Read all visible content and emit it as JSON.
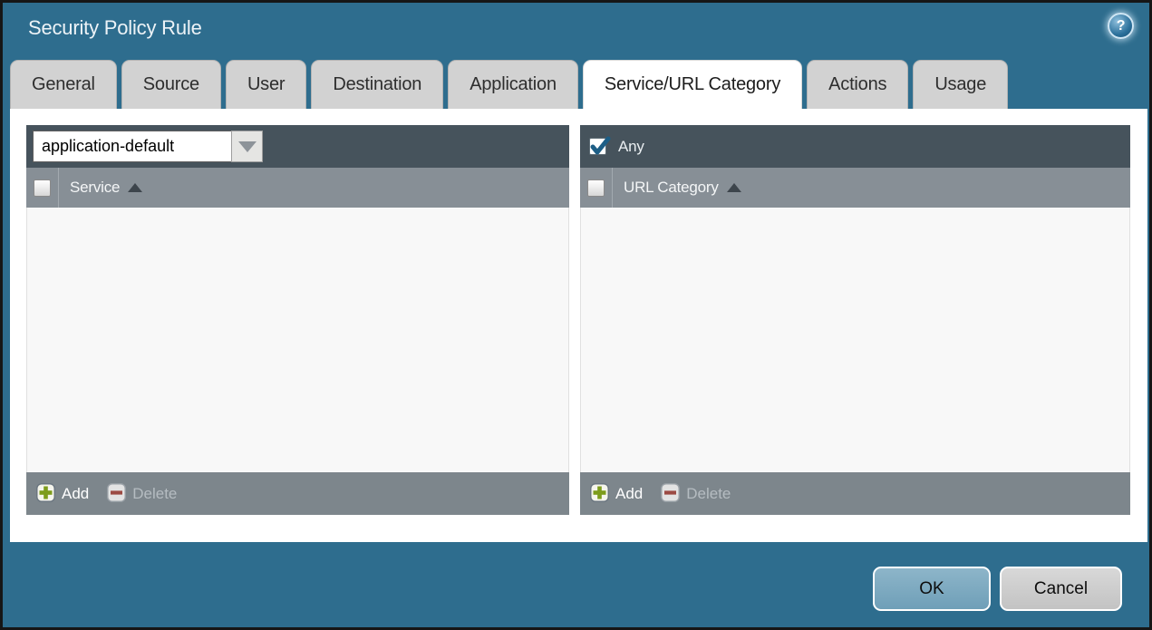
{
  "window": {
    "title": "Security Policy Rule"
  },
  "titlebar": {
    "help_glyph": "?"
  },
  "tabs": [
    {
      "label": "General",
      "active": false
    },
    {
      "label": "Source",
      "active": false
    },
    {
      "label": "User",
      "active": false
    },
    {
      "label": "Destination",
      "active": false
    },
    {
      "label": "Application",
      "active": false
    },
    {
      "label": "Service/URL Category",
      "active": true
    },
    {
      "label": "Actions",
      "active": false
    },
    {
      "label": "Usage",
      "active": false
    }
  ],
  "service_panel": {
    "dropdown": {
      "value": "application-default"
    },
    "select_all_checked": false,
    "column_header": "Service",
    "rows": [],
    "toolbar": {
      "add_label": "Add",
      "delete_label": "Delete",
      "delete_enabled": false
    }
  },
  "url_category_panel": {
    "any_label": "Any",
    "any_checked": true,
    "select_all_checked": false,
    "column_header": "URL Category",
    "rows": [],
    "toolbar": {
      "add_label": "Add",
      "delete_label": "Delete",
      "delete_enabled": false
    }
  },
  "dialog_buttons": {
    "ok_label": "OK",
    "cancel_label": "Cancel"
  },
  "colors": {
    "background_teal": "#2e6d8e",
    "panel_header_dark": "#46535c",
    "column_header_gray": "#878f96",
    "footer_bar_gray": "#7d868c",
    "add_icon_green": "#7d9c1b",
    "delete_icon_red": "#9c4a43",
    "checkmark_blue": "#1d5e86",
    "ok_button_blue": "#79a7bf",
    "cancel_button_gray": "#c9c9c9"
  }
}
